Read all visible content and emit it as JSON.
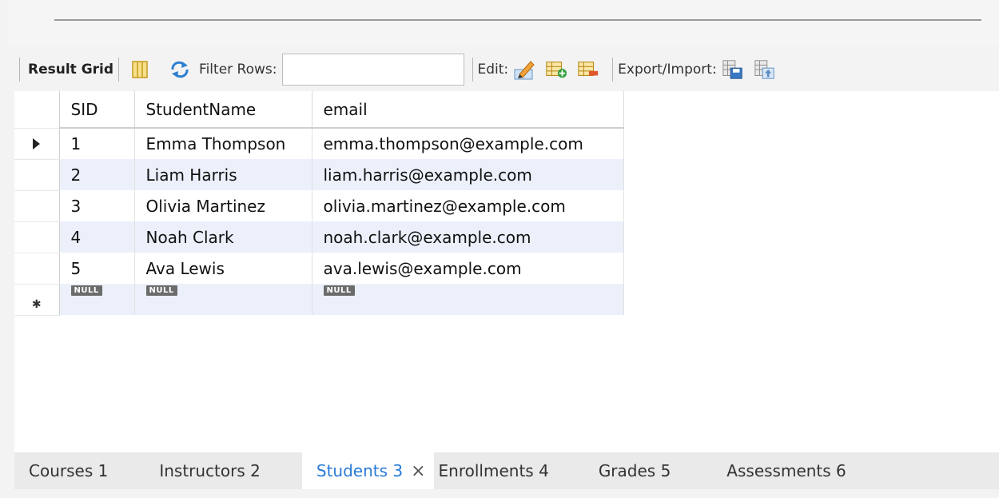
{
  "toolbar": {
    "result_grid_label": "Result Grid",
    "filter_label": "Filter Rows:",
    "filter_value": "",
    "edit_label": "Edit:",
    "export_label": "Export/Import:"
  },
  "grid": {
    "columns": [
      "SID",
      "StudentName",
      "email"
    ],
    "rows": [
      {
        "sid": "1",
        "name": "Emma Thompson",
        "email": "emma.thompson@example.com"
      },
      {
        "sid": "2",
        "name": "Liam Harris",
        "email": "liam.harris@example.com"
      },
      {
        "sid": "3",
        "name": "Olivia Martinez",
        "email": "olivia.martinez@example.com"
      },
      {
        "sid": "4",
        "name": "Noah Clark",
        "email": "noah.clark@example.com"
      },
      {
        "sid": "5",
        "name": "Ava Lewis",
        "email": "ava.lewis@example.com"
      }
    ],
    "null_label": "NULL",
    "selected_row": 0
  },
  "tabs": [
    {
      "label": "Courses 1",
      "active": false
    },
    {
      "label": "Instructors 2",
      "active": false
    },
    {
      "label": "Students 3",
      "active": true
    },
    {
      "label": "Enrollments 4",
      "active": false
    },
    {
      "label": "Grades 5",
      "active": false
    },
    {
      "label": "Assessments 6",
      "active": false
    }
  ],
  "icons": {
    "columns": "column-toggle-icon",
    "refresh": "refresh-icon",
    "edit": "edit-pencil-icon",
    "add_row": "add-row-icon",
    "delete_row": "delete-row-icon",
    "export": "export-save-icon",
    "import": "import-icon"
  },
  "colors": {
    "active_tab_text": "#2a7bd6",
    "alt_row_bg": "#ebf0fa"
  }
}
